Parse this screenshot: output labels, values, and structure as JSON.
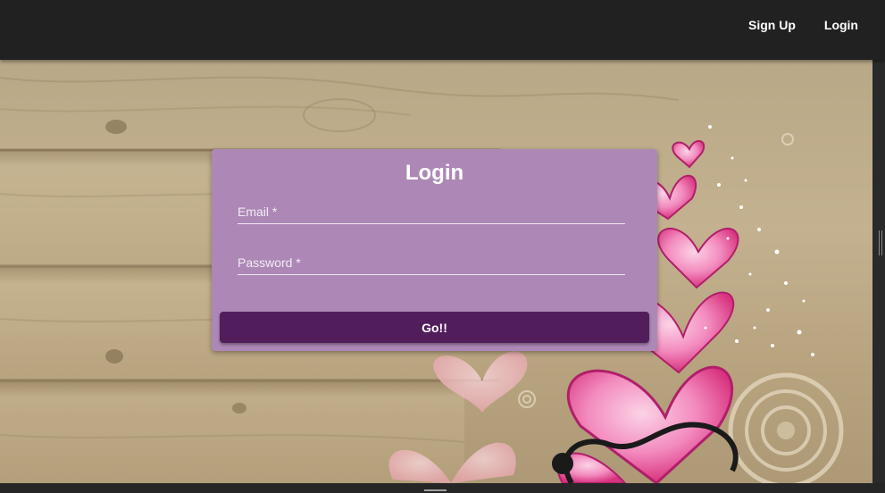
{
  "nav": {
    "signup_label": "Sign Up",
    "login_label": "Login"
  },
  "login_card": {
    "title": "Login",
    "email_placeholder": "Email *",
    "password_placeholder": "Password *",
    "submit_label": "Go!!"
  },
  "background": {
    "description_icons": [
      "wood-planks",
      "pink-hearts",
      "sparkles",
      "ring-circles"
    ]
  },
  "colors": {
    "topbar": "#212121",
    "card": "#ad88b6",
    "button": "#511e5b",
    "heart_pink": "#ee6fae"
  }
}
